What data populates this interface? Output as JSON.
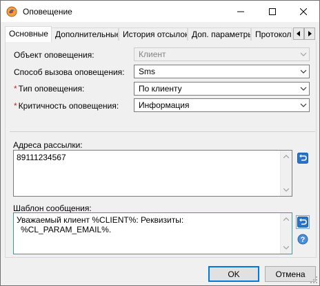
{
  "window": {
    "title": "Оповещение",
    "icons": {
      "app": "app-logo-icon",
      "minimize": "minimize-icon",
      "maximize": "maximize-icon",
      "close": "close-icon"
    }
  },
  "tabs": [
    {
      "label": "Основные",
      "active": true
    },
    {
      "label": "Дополнительные",
      "active": false
    },
    {
      "label": "История отсылок",
      "active": false
    },
    {
      "label": "Доп. параметры",
      "active": false
    },
    {
      "label": "Протокол",
      "active": false
    }
  ],
  "fields": {
    "object": {
      "label": "Объект оповещения:",
      "value": "Клиент",
      "required": false,
      "disabled": true
    },
    "method": {
      "label": "Способ вызова оповещения:",
      "value": "Sms",
      "required": false,
      "disabled": false
    },
    "type": {
      "label": "Тип оповещения:",
      "value": "По клиенту",
      "required": true,
      "disabled": false
    },
    "criticality": {
      "label": "Критичность оповещения:",
      "value": "Информация",
      "required": true,
      "disabled": false
    }
  },
  "required_mark": "*",
  "addresses": {
    "label": "Адреса рассылки:",
    "value": "89111234567"
  },
  "template": {
    "label": "Шаблон сообщения:",
    "line1": "Уважаемый клиент %CLIENT%: Реквизиты:",
    "line2": "%CL_PARAM_EMAIL%."
  },
  "buttons": {
    "ok": "OK",
    "cancel": "Отмена"
  },
  "colors": {
    "accent": "#0078d7",
    "required": "#d21f1f",
    "focus_border": "#3c9a91",
    "undo_icon": "#2a75c9"
  }
}
